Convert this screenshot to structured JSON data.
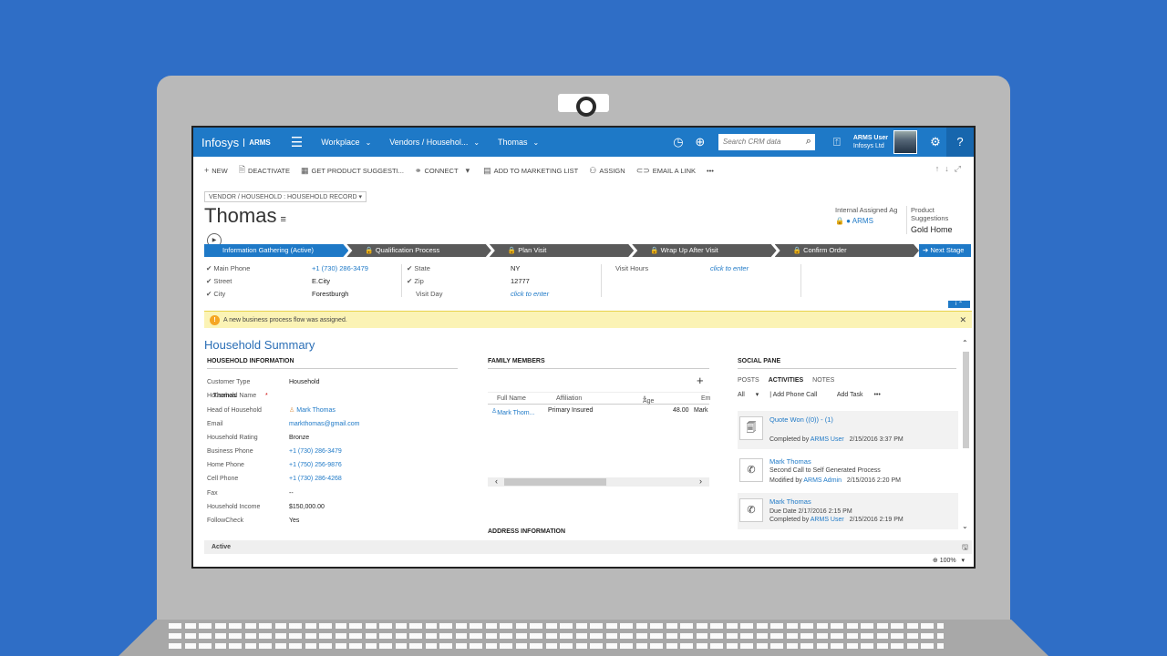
{
  "topbar": {
    "brand": "Infosys",
    "product": "ARMS",
    "nav": [
      {
        "label": "Workplace"
      },
      {
        "label": "Vendors / Househol..."
      },
      {
        "label": "Thomas"
      }
    ],
    "search_placeholder": "Search CRM data",
    "user_name": "ARMS User",
    "user_org": "Infosys Ltd",
    "help": "?"
  },
  "commands": [
    {
      "icon": "plus-icon",
      "label": "NEW"
    },
    {
      "icon": "deactivate-icon",
      "label": "DEACTIVATE"
    },
    {
      "icon": "product-icon",
      "label": "GET PRODUCT SUGGESTI..."
    },
    {
      "icon": "connect-icon",
      "label": "CONNECT"
    },
    {
      "icon": "marketing-list-icon",
      "label": "ADD TO MARKETING LIST"
    },
    {
      "icon": "assign-icon",
      "label": "ASSIGN"
    },
    {
      "icon": "link-icon",
      "label": "EMAIL A LINK"
    },
    {
      "icon": "more-icon",
      "label": "•••"
    }
  ],
  "record": {
    "breadcrumb": "VENDOR / HOUSEHOLD : HOUSEHOLD RECORD",
    "title": "Thomas",
    "header_fields": [
      {
        "label": "Internal Assigned Ag",
        "value": "ARMS"
      },
      {
        "label": "Product Suggestions",
        "value": "Gold Home"
      }
    ]
  },
  "bpf": {
    "stages": [
      {
        "label": "Information Gathering (Active)",
        "active": true
      },
      {
        "label": "Qualification Process",
        "active": false
      },
      {
        "label": "Plan Visit",
        "active": false
      },
      {
        "label": "Wrap Up After Visit",
        "active": false
      },
      {
        "label": "Confirm Order",
        "active": false
      }
    ],
    "next_label": "Next Stage",
    "fields": {
      "main_phone": {
        "label": "Main Phone",
        "value": "+1 (730) 286-3479"
      },
      "street": {
        "label": "Street",
        "value": "E.City"
      },
      "city": {
        "label": "City",
        "value": "Forestburgh"
      },
      "state": {
        "label": "State",
        "value": "NY"
      },
      "zip": {
        "label": "Zip",
        "value": "12777"
      },
      "visit_day": {
        "label": "Visit Day",
        "value": "click to enter"
      },
      "visit_hours": {
        "label": "Visit Hours",
        "value": "click to enter"
      }
    }
  },
  "notice": "A new business process flow was assigned.",
  "summary": {
    "title": "Household Summary",
    "household_info_title": "HOUSEHOLD INFORMATION",
    "rows": [
      {
        "label": "Customer Type",
        "value": "Household"
      },
      {
        "label": "Household Name",
        "value": "Thomas"
      },
      {
        "label": "Head of Household",
        "value": "Mark Thomas"
      },
      {
        "label": "Email",
        "value": "markthomas@gmail.com"
      },
      {
        "label": "Household Rating",
        "value": "Bronze"
      },
      {
        "label": "Business Phone",
        "value": "+1 (730) 286-3479"
      },
      {
        "label": "Home Phone",
        "value": "+1 (750) 256-9876"
      },
      {
        "label": "Cell Phone",
        "value": "+1 (730) 286-4268"
      },
      {
        "label": "Fax",
        "value": "--"
      },
      {
        "label": "Household Income",
        "value": "$150,000.00"
      },
      {
        "label": "FollowCheck",
        "value": "Yes"
      }
    ]
  },
  "family": {
    "title": "FAMILY MEMBERS",
    "columns": [
      "Full Name",
      "Affiliation",
      "Age",
      "Em"
    ],
    "rows": [
      {
        "name": "Mark Thom...",
        "affiliation": "Primary Insured",
        "age": "48.00",
        "em": "Mark"
      }
    ]
  },
  "address_title": "ADDRESS INFORMATION",
  "social": {
    "title": "SOCIAL PANE",
    "tabs": [
      "POSTS",
      "ACTIVITIES",
      "NOTES"
    ],
    "filter": "All",
    "actions": [
      "Add Phone Call",
      "Add Task",
      "•••"
    ],
    "activities": [
      {
        "title": "Quote Won ((0)) - (1)",
        "line1": "",
        "line2_prefix": "Completed by",
        "line2_user": "ARMS User",
        "line2_date": "2/15/2016 3:37 PM"
      },
      {
        "title": "Mark Thomas",
        "line1": "Second Call to Self Generated Process",
        "line2_prefix": "Modified by",
        "line2_user": "ARMS Admin",
        "line2_date": "2/15/2016 2:20 PM"
      },
      {
        "title": "Mark Thomas",
        "line1": "Due Date   2/17/2016 2:15 PM",
        "line2_prefix": "Completed by",
        "line2_user": "ARMS User",
        "line2_date": "2/15/2016 2:19 PM"
      }
    ]
  },
  "status": "Active",
  "zoom": "100%",
  "colors": {
    "accent": "#1e79c7",
    "background": "#2f6ec6",
    "notice": "#fbf3b5"
  }
}
